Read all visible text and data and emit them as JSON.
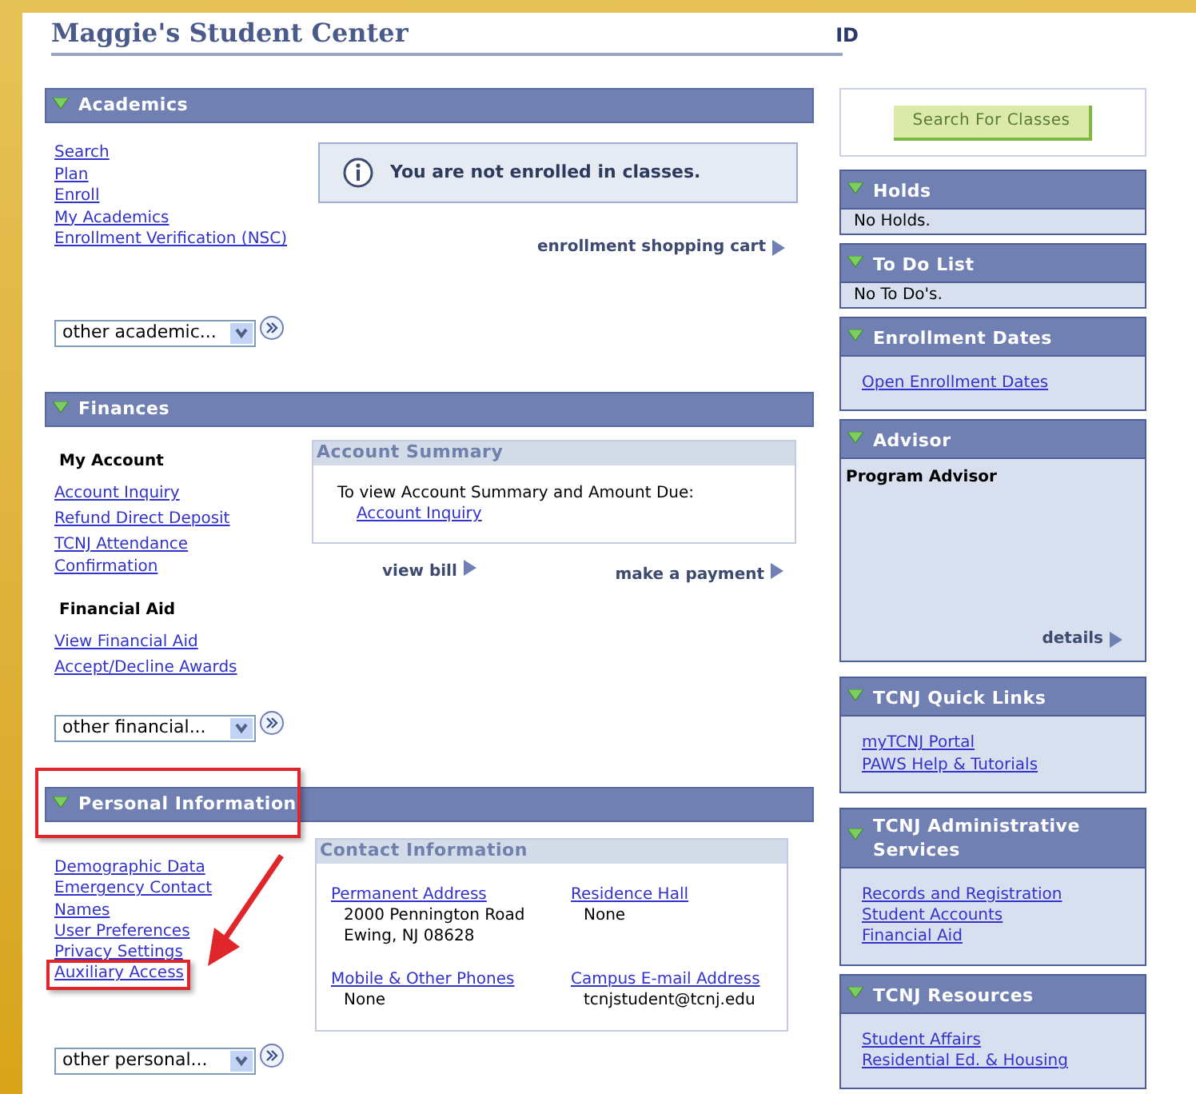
{
  "title": "Maggie's Student Center",
  "id_label": "ID",
  "academics": {
    "title": "Academics",
    "expanded": true,
    "links": [
      "Search",
      "Plan",
      "Enroll",
      "My Academics",
      "Enrollment Verification (NSC)"
    ],
    "notice": "You are not enrolled in classes.",
    "cart_link": "enrollment shopping cart",
    "dropdown": {
      "value": "other academic..."
    }
  },
  "finances": {
    "title": "Finances",
    "expanded": true,
    "groups": [
      {
        "heading": "My Account",
        "links": [
          "Account Inquiry",
          "Refund Direct Deposit",
          "TCNJ Attendance Confirmation"
        ]
      },
      {
        "heading": "Financial Aid",
        "links": [
          "View Financial Aid",
          "Accept/Decline Awards"
        ]
      }
    ],
    "summary": {
      "title": "Account Summary",
      "text": "To view Account Summary and Amount Due:",
      "link": "Account Inquiry"
    },
    "actions": [
      "view bill",
      "make a payment"
    ],
    "dropdown": {
      "value": "other financial..."
    }
  },
  "personal": {
    "title": "Personal Information",
    "expanded": true,
    "highlighted": true,
    "links": [
      {
        "label": "Demographic Data",
        "highlighted": false
      },
      {
        "label": "Emergency Contact",
        "highlighted": false
      },
      {
        "label": "Names",
        "highlighted": false
      },
      {
        "label": "User Preferences",
        "highlighted": false
      },
      {
        "label": "Privacy Settings",
        "highlighted": false
      },
      {
        "label": "Auxiliary Access",
        "highlighted": true
      }
    ],
    "contact": {
      "title": "Contact Information",
      "fields": [
        {
          "label": "Permanent Address",
          "lines": [
            "2000 Pennington Road",
            "Ewing, NJ 08628"
          ]
        },
        {
          "label": "Residence Hall",
          "lines": [
            "None"
          ]
        },
        {
          "label": "Mobile & Other Phones",
          "lines": [
            "None"
          ]
        },
        {
          "label": "Campus E-mail Address",
          "lines": [
            "tcnjstudent@tcnj.edu"
          ]
        }
      ]
    },
    "dropdown": {
      "value": "other personal..."
    }
  },
  "search_button": "Search For Classes",
  "panels": [
    {
      "kind": "text",
      "title": "Holds",
      "expanded": true,
      "text": "No Holds."
    },
    {
      "kind": "text",
      "title": "To Do List",
      "expanded": true,
      "text": "No To Do's."
    },
    {
      "kind": "links",
      "title": "Enrollment Dates",
      "expanded": true,
      "links": [
        "Open Enrollment Dates"
      ]
    },
    {
      "kind": "advisor",
      "title": "Advisor",
      "expanded": true,
      "heading": "Program Advisor",
      "link": "details"
    },
    {
      "kind": "links",
      "title": "TCNJ Quick Links",
      "expanded": true,
      "links": [
        "myTCNJ Portal",
        "PAWS Help & Tutorials"
      ]
    },
    {
      "kind": "links",
      "title": "TCNJ Administrative Services",
      "expanded": true,
      "links": [
        "Records and Registration",
        "Student Accounts",
        "Financial Aid"
      ]
    },
    {
      "kind": "links",
      "title": "TCNJ Resources",
      "expanded": true,
      "links": [
        "Student Affairs",
        "Residential Ed. & Housing"
      ]
    }
  ]
}
